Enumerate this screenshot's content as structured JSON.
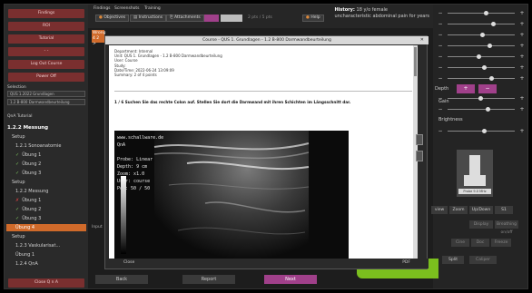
{
  "sidebar": {
    "buttons": [
      "Findings",
      "ROI",
      "Tutorial",
      "- -",
      "Log Out Course",
      "Power Off"
    ],
    "select1_label": "Selection",
    "select1_value": "QUS 1.2022 Grundlagen",
    "select2_value": "1.2 B-800 Darmwandbeurteilung",
    "section_tutorial": "QnA Tutorial",
    "section_heading": "1.2.2 Messung",
    "items": [
      {
        "label": "Setup",
        "state": "none",
        "indent": false
      },
      {
        "label": "1.2.1 Sonoanatomie",
        "state": "none",
        "indent": true
      },
      {
        "label": "Übung 1",
        "state": "check",
        "indent": true
      },
      {
        "label": "Übung 2",
        "state": "check",
        "indent": true
      },
      {
        "label": "Übung 3",
        "state": "check",
        "indent": true
      },
      {
        "label": "Setup",
        "state": "none",
        "indent": false
      },
      {
        "label": "1.2.2 Messung",
        "state": "none",
        "indent": true
      },
      {
        "label": "Übung 1",
        "state": "x",
        "indent": true
      },
      {
        "label": "Übung 2",
        "state": "check",
        "indent": true
      },
      {
        "label": "Übung 3",
        "state": "check",
        "indent": true
      },
      {
        "label": "Übung 4",
        "state": "active",
        "indent": true
      },
      {
        "label": "Setup",
        "state": "none",
        "indent": false
      },
      {
        "label": "1.2.3 Vaskularisat...",
        "state": "none",
        "indent": true
      },
      {
        "label": "Übung 1",
        "state": "none",
        "indent": true
      },
      {
        "label": "1.2.4 QnA",
        "state": "none",
        "indent": true
      }
    ],
    "close_button": "Close Q n A"
  },
  "topbar": {
    "tabs": [
      "Findings",
      "Screenshots",
      "Training"
    ],
    "objectives": "Objectives",
    "instructions": "Instructions",
    "attachments": "Attachments",
    "help": "Help",
    "counter": "2 pts / 5 pts",
    "side_badge": "Wrong",
    "side_badge2": "4 2 >",
    "history_title": "History:",
    "history_text": "18 y/o female",
    "history_line2": "uncharacteristic abdominal pain for years"
  },
  "rpanel": {
    "depth_label": "Depth",
    "gain_label": "Gain",
    "brightness_label": "Brightness",
    "probe_caption": "Probe 9.0 MHz",
    "view": "view",
    "zoom": "Zoom",
    "updown": "Up/Down",
    "s1": "S1",
    "btns2": [
      "Display",
      "Doppler",
      "Breathing on/off"
    ],
    "btns3": [
      "Cine",
      "Doc",
      "Freeze"
    ],
    "split": "Split",
    "sonomarker": "Caliper"
  },
  "bottom": {
    "back": "Back",
    "report": "Report",
    "next": "Next",
    "input": "Input"
  },
  "modal": {
    "title": "Course - QUS 1. Grundlagen - 1.2 B-800 Darmwandbeurteilung",
    "meta": [
      "Department: Internal",
      "Unit: QUS 1. Grundlagen - 1.2 B-800 Darmwandbeurteilung",
      "User: Course",
      "Study:",
      "Date/Time: 2022-06-24 13:09:09",
      "Summary: 2 of 4 points"
    ],
    "question": "1 / 6 Suchen Sie das rechte Colon auf. Stellen Sie dort die Darmwand mit ihren Schichten im Längsschnitt dar.",
    "us_overlay": "www.schallware.de\nQnA\n\nProbe: Linear\nDepth: 9 cm\nZoom: x1.0\nUser: course\nPos: 50 / 50",
    "close": "Close",
    "pdf": "PDF"
  }
}
